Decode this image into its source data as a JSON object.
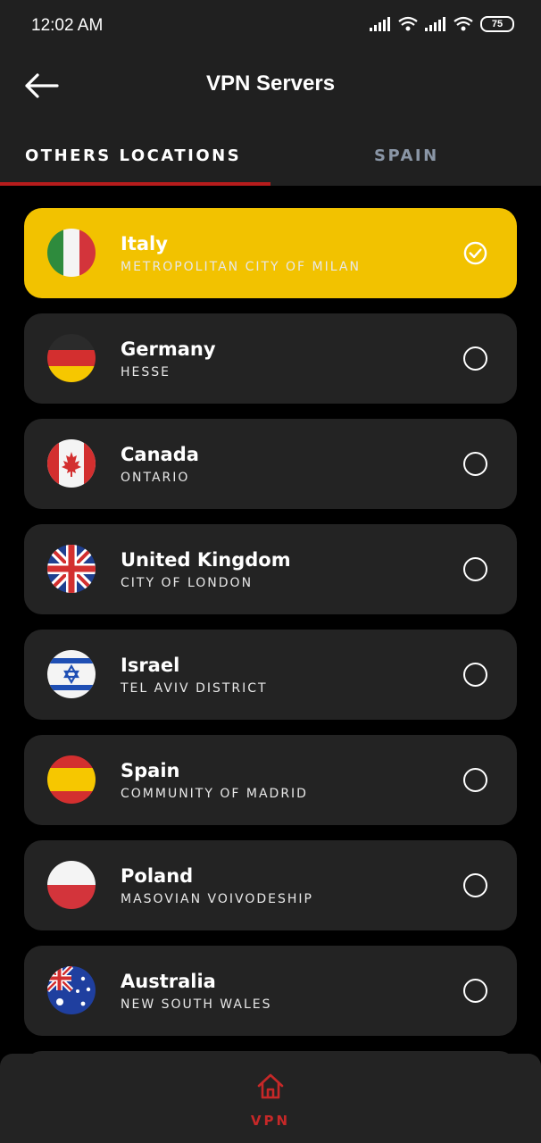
{
  "status_bar": {
    "time": "12:02 AM",
    "battery": "75"
  },
  "header": {
    "title": "VPN Servers"
  },
  "tabs": [
    {
      "label": "OTHERS LOCATIONS",
      "active": true
    },
    {
      "label": "SPAIN",
      "active": false
    }
  ],
  "servers": [
    {
      "country": "Italy",
      "region": "METROPOLITAN CITY OF MILAN",
      "flag": "italy-flag",
      "selected": true
    },
    {
      "country": "Germany",
      "region": "HESSE",
      "flag": "germany-flag",
      "selected": false
    },
    {
      "country": "Canada",
      "region": "ONTARIO",
      "flag": "canada-flag",
      "selected": false
    },
    {
      "country": "United Kingdom",
      "region": "CITY OF LONDON",
      "flag": "uk-flag",
      "selected": false
    },
    {
      "country": "Israel",
      "region": "TEL AVIV DISTRICT",
      "flag": "israel-flag",
      "selected": false
    },
    {
      "country": "Spain",
      "region": "COMMUNITY OF MADRID",
      "flag": "spain-flag",
      "selected": false
    },
    {
      "country": "Poland",
      "region": "MASOVIAN VOIVODESHIP",
      "flag": "poland-flag",
      "selected": false
    },
    {
      "country": "Australia",
      "region": "NEW SOUTH WALES",
      "flag": "australia-flag",
      "selected": false
    }
  ],
  "bottom_nav": {
    "label": "VPN",
    "icon": "home-icon"
  },
  "colors": {
    "accent": "#b71c1c",
    "selected_card": "#f2c200",
    "card": "#232323",
    "inactive_tab": "#8a96a6"
  }
}
